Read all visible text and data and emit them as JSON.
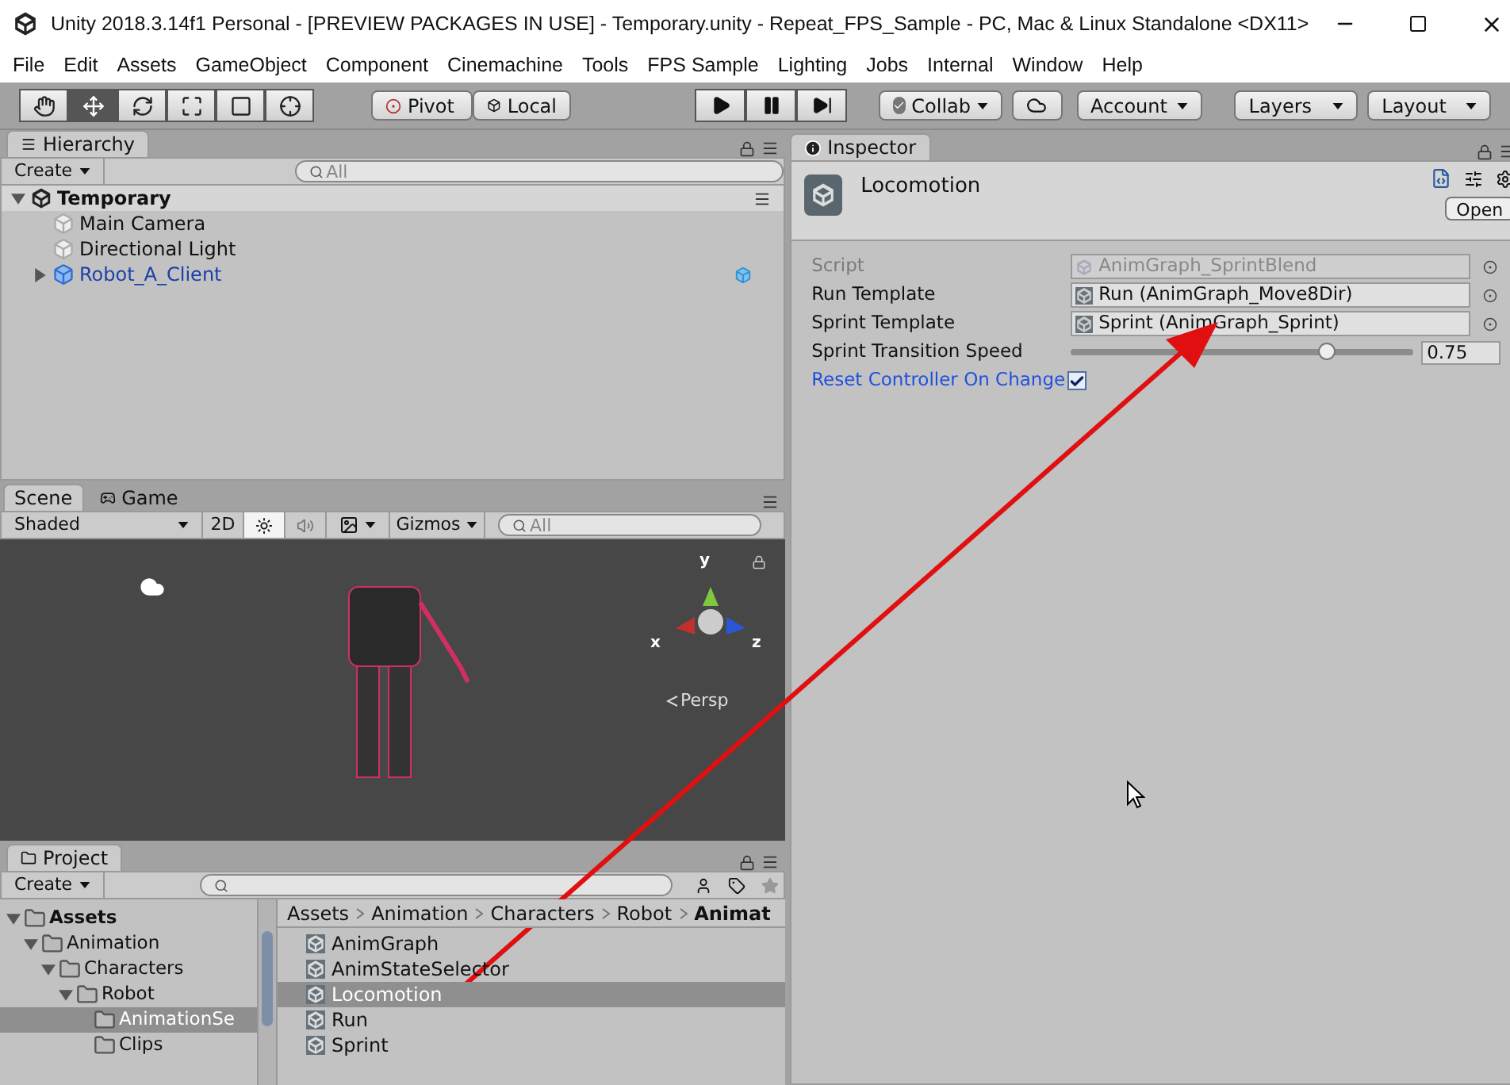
{
  "window": {
    "title": "Unity 2018.3.14f1 Personal - [PREVIEW PACKAGES IN USE] - Temporary.unity - Repeat_FPS_Sample - PC, Mac & Linux Standalone <DX11>"
  },
  "menu": [
    "File",
    "Edit",
    "Assets",
    "GameObject",
    "Component",
    "Cinemachine",
    "Tools",
    "FPS Sample",
    "Lighting",
    "Jobs",
    "Internal",
    "Window",
    "Help"
  ],
  "toolbar": {
    "tools": [
      {
        "kind": "hand",
        "selected": false
      },
      {
        "kind": "move",
        "selected": true
      },
      {
        "kind": "rotate",
        "selected": false
      },
      {
        "kind": "scale",
        "selected": false
      },
      {
        "kind": "rect",
        "selected": false
      },
      {
        "kind": "transform",
        "selected": false
      }
    ],
    "pivot": [
      {
        "label": "Pivot",
        "kind": "pivot"
      },
      {
        "label": "Local",
        "kind": "local"
      }
    ],
    "play": [
      {
        "kind": "play"
      },
      {
        "kind": "pause"
      },
      {
        "kind": "step"
      }
    ],
    "collab": "Collab",
    "account": "Account",
    "layers": "Layers",
    "layout": "Layout"
  },
  "hierarchy": {
    "tab": "Hierarchy",
    "create": "Create",
    "search_placeholder": "All",
    "tree": [
      {
        "label": "Temporary",
        "kind": "scene",
        "expanded": true,
        "children": [
          {
            "label": "Main Camera",
            "kind": "object"
          },
          {
            "label": "Directional Light",
            "kind": "object"
          },
          {
            "label": "Robot_A_Client",
            "kind": "prefab",
            "expanded": false
          }
        ]
      }
    ]
  },
  "scene": {
    "tabs": [
      {
        "label": "Scene",
        "selected": true
      },
      {
        "label": "Game",
        "selected": false
      }
    ],
    "shading": "Shaded",
    "mode_2d": "2D",
    "lighting_on": true,
    "audio_on": false,
    "gizmos": "Gizmos",
    "search_placeholder": "All",
    "axes": {
      "y": "y",
      "x": "x",
      "z": "z"
    },
    "projection": "Persp"
  },
  "project": {
    "tab": "Project",
    "create": "Create",
    "folders": [
      {
        "label": "Assets",
        "expanded": true,
        "selected": false,
        "children": [
          {
            "label": "Animation",
            "expanded": true,
            "selected": false,
            "children": [
              {
                "label": "Characters",
                "expanded": true,
                "selected": false,
                "children": [
                  {
                    "label": "Robot",
                    "expanded": true,
                    "selected": false,
                    "children": [
                      {
                        "label": "AnimationSe",
                        "selected": true
                      },
                      {
                        "label": "Clips",
                        "selected": false
                      }
                    ]
                  }
                ]
              }
            ]
          }
        ]
      }
    ],
    "breadcrumb": [
      "Assets",
      "Animation",
      "Characters",
      "Robot",
      "Animat"
    ],
    "assets": [
      {
        "label": "AnimGraph",
        "selected": false
      },
      {
        "label": "AnimStateSelector",
        "selected": false
      },
      {
        "label": "Locomotion",
        "selected": true
      },
      {
        "label": "Run",
        "selected": false
      },
      {
        "label": "Sprint",
        "selected": false
      }
    ]
  },
  "inspector": {
    "tab": "Inspector",
    "asset_name": "Locomotion",
    "open": "Open",
    "fields": [
      {
        "kind": "object",
        "label": "Script",
        "value": "AnimGraph_SprintBlend",
        "disabled": true
      },
      {
        "kind": "object",
        "label": "Run Template",
        "value": "Run (AnimGraph_Move8Dir)",
        "disabled": false
      },
      {
        "kind": "object",
        "label": "Sprint Template",
        "value": "Sprint (AnimGraph_Sprint)",
        "disabled": false
      },
      {
        "kind": "slider",
        "label": "Sprint Transition Speed",
        "level": 0.75,
        "value": "0.75"
      },
      {
        "kind": "checkbox",
        "label": "Reset Controller On Change",
        "checked": true,
        "overridden": true
      }
    ]
  }
}
